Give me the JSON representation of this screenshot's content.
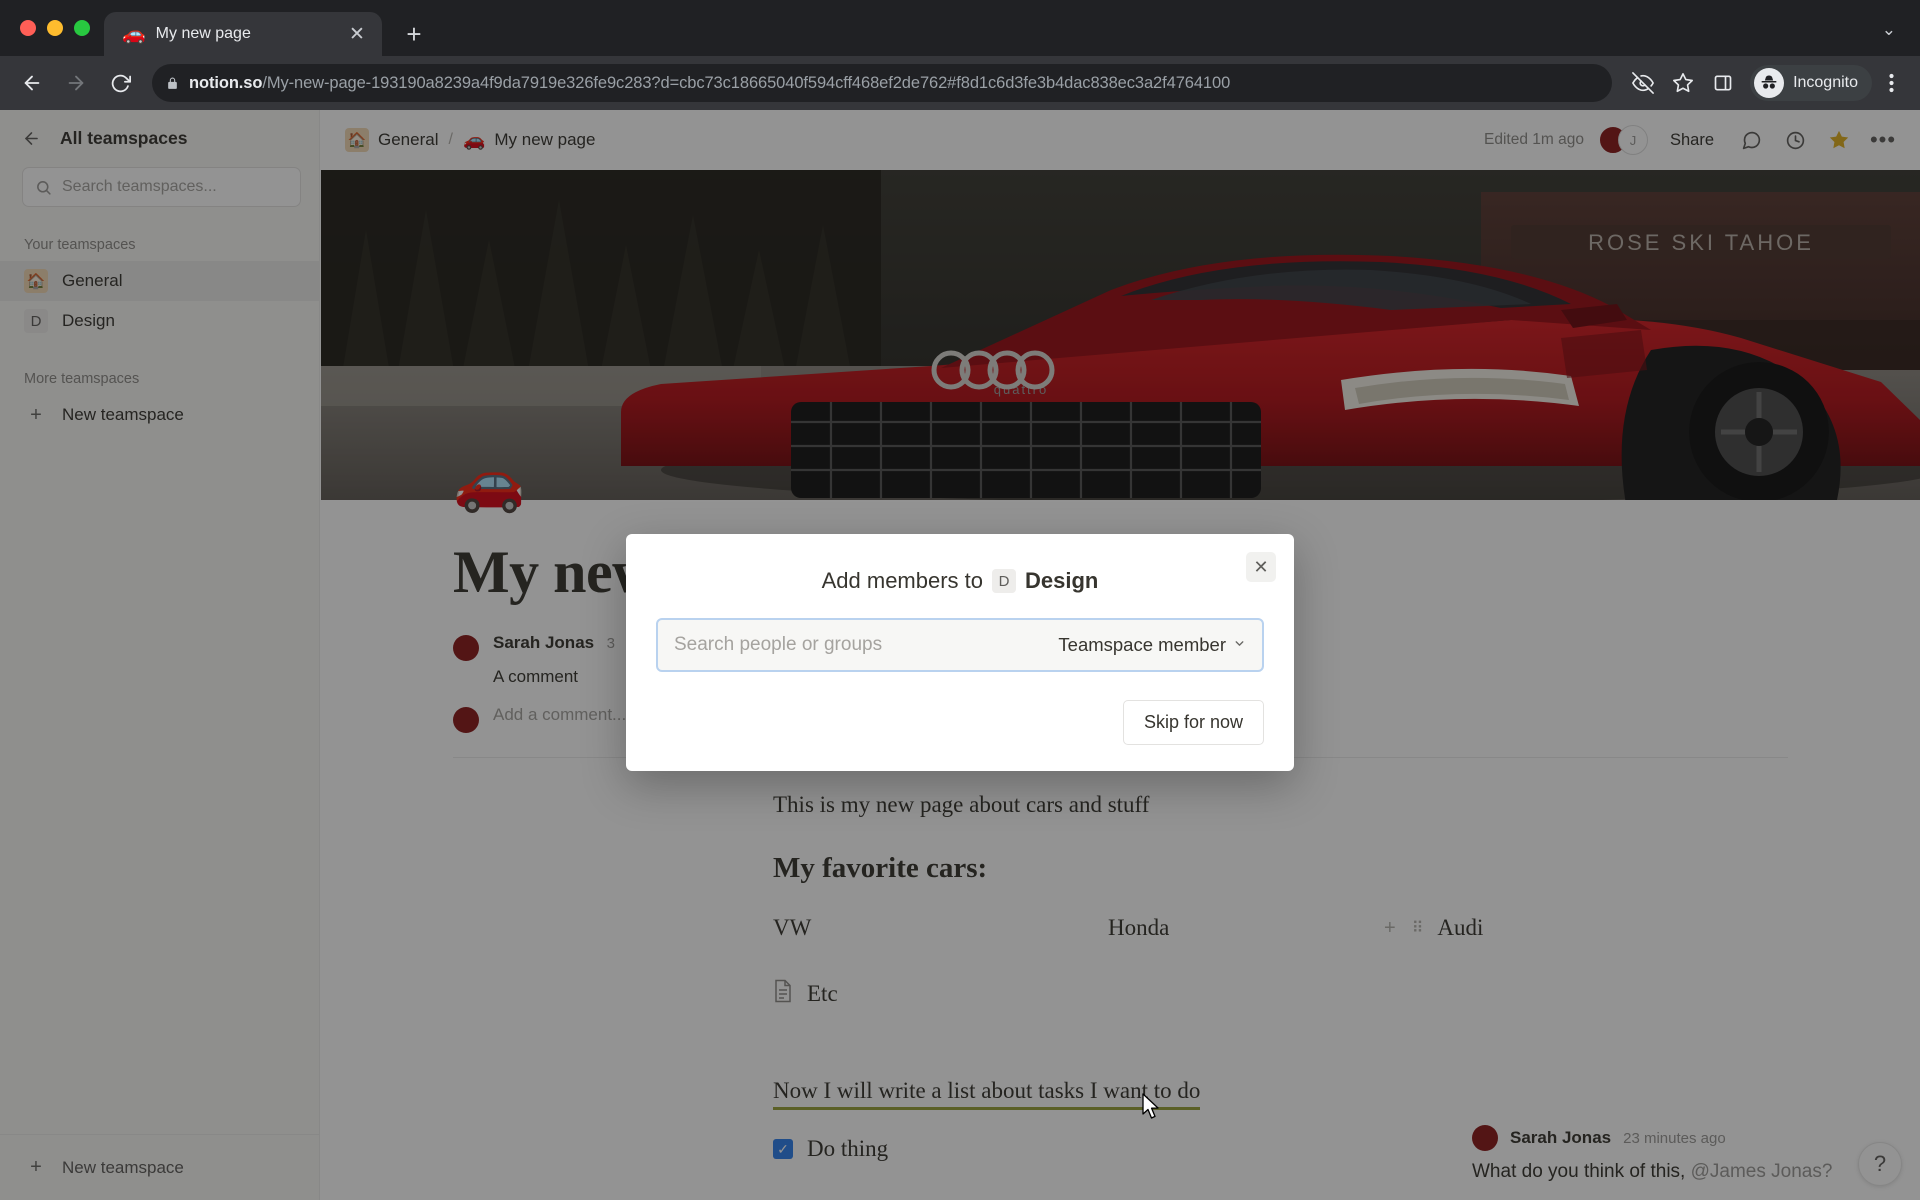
{
  "browser": {
    "tab": {
      "title": "My new page",
      "favicon": "red-car-emoji",
      "close_label": "✕"
    },
    "new_tab_label": "+",
    "tabstrip_chevron": "⌄",
    "nav": {
      "back": "←",
      "forward": "→",
      "reload": "⟳"
    },
    "url": {
      "lock": "🔒",
      "host": "notion.so",
      "path": "/My-new-page-193190a8239a4f9da7919e326fe9c283?d=cbc73c18665040f594cff468ef2de762#f8d1c6d3fe3b4dac838ec3a2f4764100"
    },
    "omni_icons": [
      "eye-slash-icon",
      "star-icon",
      "side-panel-icon"
    ],
    "profile": {
      "label": "Incognito",
      "icon": "incognito-hat-icon"
    },
    "menu_label": "⋮"
  },
  "sidebar": {
    "back_label": "←",
    "header_title": "All teamspaces",
    "search": {
      "placeholder": "Search teamspaces...",
      "icon": "search-icon"
    },
    "sections": [
      {
        "label": "Your teamspaces"
      },
      {
        "label": "More teamspaces"
      }
    ],
    "items": [
      {
        "label": "General",
        "icon": "house-emoji",
        "glyph": "🏠",
        "active": true
      },
      {
        "label": "Design",
        "icon": "letter-d-icon",
        "glyph": "D",
        "active": false
      }
    ],
    "new_teamspace_label": "New teamspace",
    "footer_new_teamspace_label": "New teamspace"
  },
  "topbar": {
    "breadcrumb": [
      {
        "label": "General",
        "glyph": "🏠"
      },
      {
        "label": "My new page",
        "glyph": "🚗"
      }
    ],
    "separator": "/",
    "edited_label": "Edited 1m ago",
    "avatars": [
      {
        "name": "Sarah Jonas",
        "initial": "S",
        "color": "#8b1a1a"
      },
      {
        "name": "James Jonas",
        "initial": "J",
        "color": "#ffffff"
      }
    ],
    "share_label": "Share",
    "icons": [
      "comment-icon",
      "history-clock-icon",
      "star-icon",
      "more-dots-icon"
    ]
  },
  "page": {
    "cover_alt": "red Audi R8 sports car in a snowy mountain parking lot",
    "cover_sign_text": "ROSE SKI TAHOE",
    "emoji": "🚗",
    "title": "My new page",
    "inline_comment": {
      "author": "Sarah Jonas",
      "time": "3",
      "text": "A comment",
      "add_placeholder": "Add a comment..."
    },
    "paragraph": "This is my new page about cars and stuff",
    "heading": "My favorite cars:",
    "columns": [
      "VW",
      "Honda",
      "Audi"
    ],
    "column_handles": {
      "plus": "+",
      "drag": "⠿"
    },
    "etc": {
      "label": "Etc",
      "icon": "page-document-icon"
    },
    "callout": "Now I will write a list about tasks I want to do",
    "todo": {
      "label": "Do thing",
      "checked": true,
      "check_glyph": "✓"
    }
  },
  "side_comment": {
    "author": "Sarah Jonas",
    "time": "23 minutes ago",
    "text_before": "What do you think of this, ",
    "mention": "@James Jonas?",
    "help_label": "?"
  },
  "modal": {
    "title_prefix": "Add members to",
    "badge": "D",
    "teamspace": "Design",
    "close_label": "✕",
    "search_placeholder": "Search people or groups",
    "role_label": "Teamspace member",
    "role_chevron": "⌄",
    "skip_label": "Skip for now"
  },
  "colors": {
    "accent_blue": "#2f80ed",
    "focus_border": "#b9d2ef",
    "avatar_red": "#8b1a1a",
    "star_gold": "#e0b01f",
    "callout_underline": "#9aa33b",
    "sidebar_bg": "#f7f7f5"
  }
}
